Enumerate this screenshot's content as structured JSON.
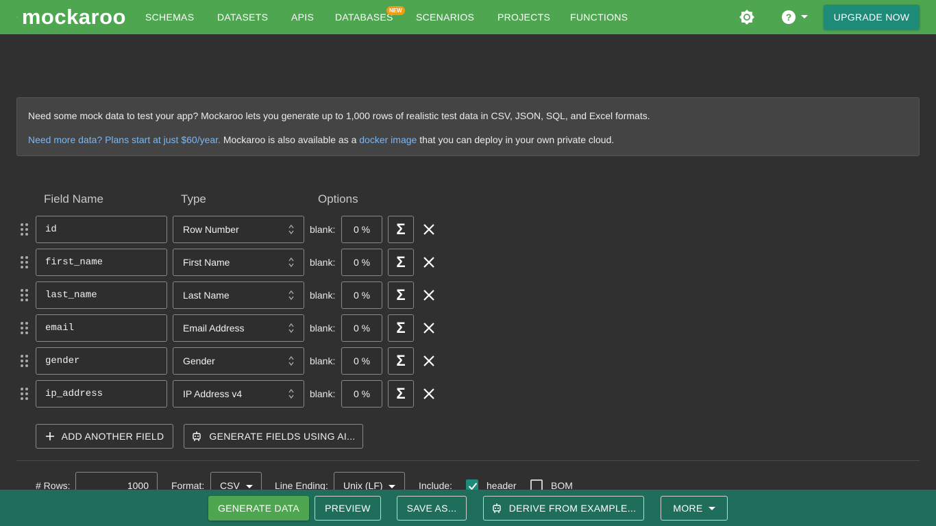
{
  "brand": {
    "name": "mockaroo"
  },
  "nav": {
    "items": [
      "SCHEMAS",
      "DATASETS",
      "APIS",
      "DATABASES",
      "SCENARIOS",
      "PROJECTS",
      "FUNCTIONS"
    ],
    "badge": "NEW",
    "upgrade_label": "UPGRADE NOW"
  },
  "info": {
    "line1": "Need some mock data to test your app? Mockaroo lets you generate up to 1,000 rows of realistic test data in CSV, JSON, SQL, and Excel formats.",
    "link1": "Need more data? Plans start at just $60/year.",
    "mid_text": " Mockaroo is also available as a ",
    "link2": "docker image",
    "tail_text": " that you can deploy in your own private cloud."
  },
  "columns": {
    "field_name": "Field Name",
    "type": "Type",
    "options": "Options"
  },
  "fields": [
    {
      "name": "id",
      "type": "Row Number",
      "blank_label": "blank:",
      "blank": "0 %"
    },
    {
      "name": "first_name",
      "type": "First Name",
      "blank_label": "blank:",
      "blank": "0 %"
    },
    {
      "name": "last_name",
      "type": "Last Name",
      "blank_label": "blank:",
      "blank": "0 %"
    },
    {
      "name": "email",
      "type": "Email Address",
      "blank_label": "blank:",
      "blank": "0 %"
    },
    {
      "name": "gender",
      "type": "Gender",
      "blank_label": "blank:",
      "blank": "0 %"
    },
    {
      "name": "ip_address",
      "type": "IP Address v4",
      "blank_label": "blank:",
      "blank": "0 %"
    }
  ],
  "sigma_symbol": "Σ",
  "actions": {
    "add_field": "ADD ANOTHER FIELD",
    "generate_ai": "GENERATE FIELDS USING AI..."
  },
  "options": {
    "rows_label": "# Rows:",
    "rows_value": "1000",
    "format_label": "Format:",
    "format_value": "CSV",
    "line_ending_label": "Line Ending:",
    "line_ending_value": "Unix (LF)",
    "include_label": "Include:",
    "header_label": "header",
    "header_checked": true,
    "bom_label": "BOM",
    "bom_checked": false
  },
  "bottom": {
    "generate": "GENERATE DATA",
    "preview": "PREVIEW",
    "save_as": "SAVE AS...",
    "derive": "DERIVE FROM EXAMPLE...",
    "more": "MORE"
  },
  "colors": {
    "nav_green": "#4ea651",
    "upgrade_teal": "#1e8a78",
    "bottom_bar": "#1f6e5c",
    "badge_orange": "#f39c12",
    "link_blue": "#7cb7ef",
    "checkbox_teal": "#1e8a78"
  },
  "icons": {
    "logo": "kangaroo-icon",
    "theme": "brightness-icon",
    "help": "help-circle-icon",
    "drag": "drag-handle-icon",
    "sigma": "sigma-icon",
    "delete": "close-icon",
    "add": "plus-icon",
    "robot": "robot-icon"
  }
}
